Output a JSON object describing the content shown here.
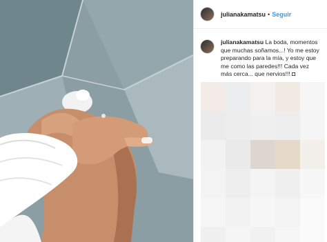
{
  "post": {
    "username": "julianakamatsu",
    "separator": "•",
    "follow_label": "Seguir",
    "caption_username": "julianakamatsu",
    "caption_text": "La boda, momentos que muchas soñamos...! Yo me estoy preparando para la mía, y estoy que me como las paredes!!! Cada vez más cerca... que nervios!!! ◘"
  },
  "image": {
    "description_icon": "photo-of-knees-and-hand-with-lace-sleeve"
  },
  "colors": {
    "link_blue": "#3897f0",
    "text": "#262626"
  }
}
